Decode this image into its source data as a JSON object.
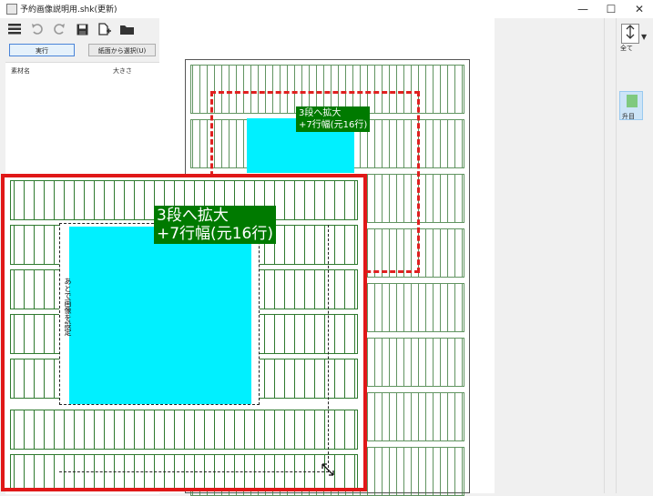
{
  "window": {
    "title": "予約画像説明用.shk(更新)",
    "buttons": {
      "minimize": "—",
      "maximize": "☐",
      "close": "✕"
    }
  },
  "toolbar": {
    "icons": [
      "menu-icon",
      "undo-icon",
      "redo-icon",
      "save-icon",
      "new-document-icon",
      "folder-icon"
    ]
  },
  "left_panel": {
    "run_button": "実行",
    "select_from_paper_button": "紙面から選択(U)",
    "columns": [
      "素材名",
      "大きさ"
    ]
  },
  "right_panel": {
    "zoom_label": "全て",
    "spread_label": "升目"
  },
  "annotation": {
    "small_label": "3段へ拡大\n+7行幅(元16行)",
    "big_label": "3段へ拡大\n+7行幅(元16行)",
    "vertical_text": "あとで画像を設定"
  },
  "colors": {
    "highlight_red": "#e01818",
    "label_green": "#007a00",
    "cyan_fill": "#00f0ff",
    "grid_green": "#2f7a2f"
  }
}
